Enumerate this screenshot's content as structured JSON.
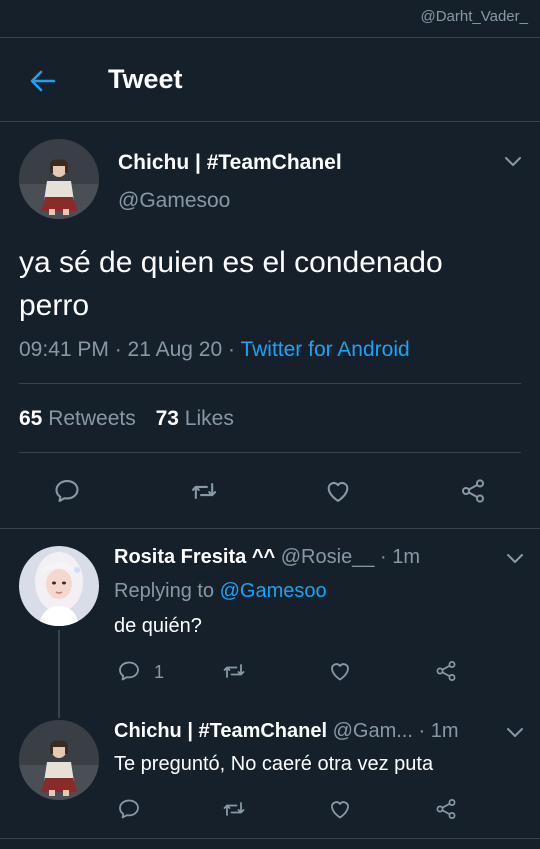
{
  "watermark": "@Darht_Vader_",
  "header": {
    "title": "Tweet"
  },
  "tweet": {
    "author_name": "Chichu | #TeamChanel",
    "author_handle": "@Gamesoo",
    "text": "ya sé de quien es el condenado perro",
    "time": "09:41 PM · 21 Aug 20 · ",
    "source": "Twitter for Android",
    "retweets_count": "65",
    "retweets_label": "Retweets",
    "likes_count": "73",
    "likes_label": "Likes"
  },
  "replies": [
    {
      "name": "Rosita Fresita ^^",
      "handle": "@Rosie__ · 1m",
      "replying_prefix": "Replying to ",
      "replying_to": "@Gamesoo",
      "text": "de quién?",
      "reply_count": "1"
    },
    {
      "name": "Chichu | #TeamChanel",
      "handle": "@Gam... · 1m",
      "text": "Te preguntó, No caeré otra vez puta"
    }
  ],
  "icons": {
    "back": "arrow-left-icon",
    "more": "chevron-down-icon",
    "reply": "comment-icon",
    "retweet": "retweet-icon",
    "like": "heart-icon",
    "share": "share-icon"
  },
  "colors": {
    "background": "#15202b",
    "accent": "#1da1f2",
    "secondary_text": "#8899a6",
    "divider": "#38444d"
  }
}
